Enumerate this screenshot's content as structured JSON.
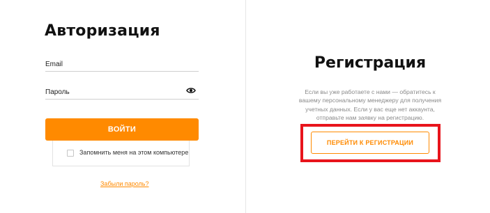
{
  "login": {
    "title": "Авторизация",
    "email_placeholder": "Email",
    "password_placeholder": "Пароль",
    "submit_label": "ВОЙТИ",
    "remember_label": "Запомнить меня на этом компьютере",
    "remember_checked": false,
    "forgot_label": "Забыли пароль?",
    "password_toggle_icon": "eye-icon"
  },
  "register": {
    "title": "Регистрация",
    "description": "Если вы уже работаете с нами — обратитесь к вашему персональному менеджеру для получения учетных данных. Если у вас еще нет аккаунта, отправьте нам заявку на регистрацию.",
    "button_label": "ПЕРЕЙТИ К РЕГИСТРАЦИИ"
  },
  "colors": {
    "accent": "#ff8a00",
    "highlight": "#e8141c",
    "text": "#111111",
    "muted_text": "#8a8a8a"
  }
}
